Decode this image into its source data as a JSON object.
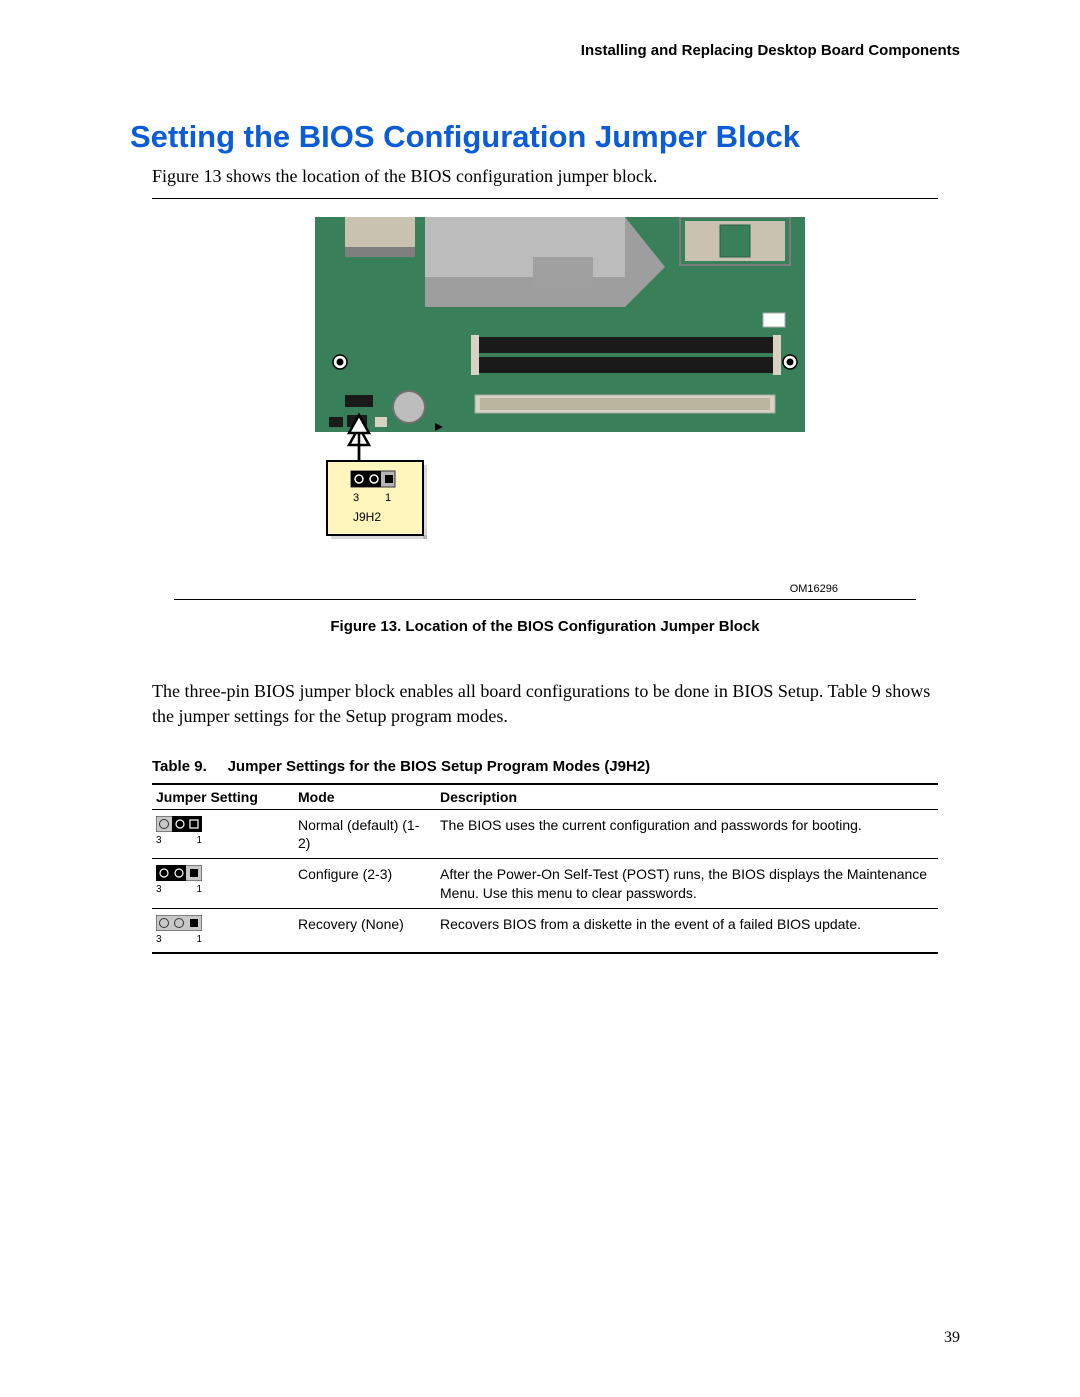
{
  "header": {
    "running_head": "Installing and Replacing Desktop Board Components"
  },
  "heading": "Setting the BIOS Configuration Jumper Block",
  "intro": "Figure 13 shows the location of the BIOS configuration jumper block.",
  "figure": {
    "om_number": "OM16296",
    "caption": "Figure 13.  Location of the BIOS Configuration Jumper Block",
    "callout": {
      "jumper_id": "J9H2",
      "pin_left": "3",
      "pin_right": "1"
    }
  },
  "body_paragraph": "The three-pin BIOS jumper block enables all board configurations to be done in BIOS Setup. Table 9 shows the jumper settings for the Setup program modes.",
  "table": {
    "caption_prefix": "Table 9.",
    "caption_title": "Jumper Settings for the BIOS Setup Program Modes (J9H2)",
    "headers": {
      "col1": "Jumper Setting",
      "col2": "Mode",
      "col3": "Description"
    },
    "rows": [
      {
        "pins": {
          "left": "3",
          "right": "1"
        },
        "mode": "Normal (default) (1-2)",
        "desc": "The BIOS uses the current configuration and passwords for booting."
      },
      {
        "pins": {
          "left": "3",
          "right": "1"
        },
        "mode": "Configure (2-3)",
        "desc": "After the Power-On Self-Test (POST) runs, the BIOS displays the Maintenance Menu.  Use this menu to clear passwords."
      },
      {
        "pins": {
          "left": "3",
          "right": "1"
        },
        "mode": "Recovery (None)",
        "desc": "Recovers BIOS from a diskette in the event of a failed BIOS update."
      }
    ]
  },
  "page_number": "39"
}
